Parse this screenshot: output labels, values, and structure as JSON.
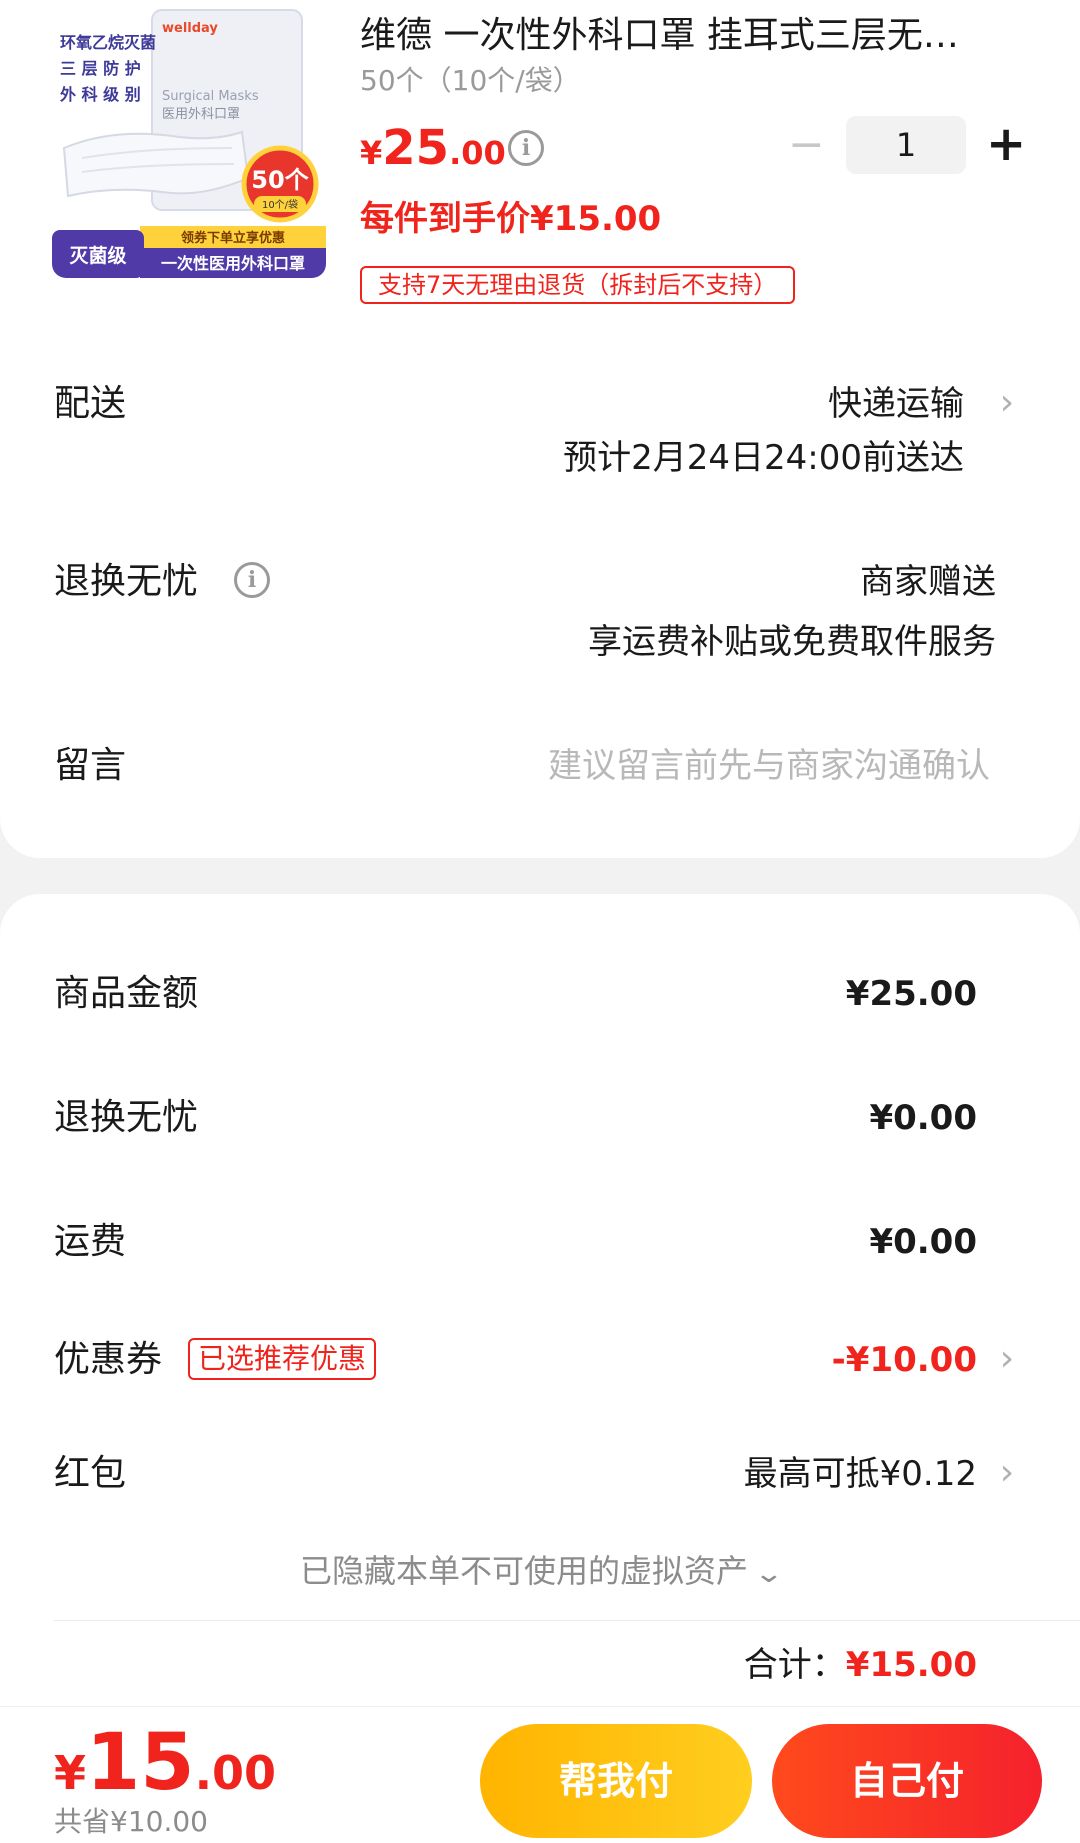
{
  "product": {
    "title": "维德 一次性外科口罩 挂耳式三层无…",
    "spec": "50个（10个/袋）",
    "price_currency": "¥",
    "price_int": "25",
    "price_dec": ".00",
    "quantity": "1",
    "minus_label": "−",
    "plus_label": "+",
    "unit_price": "每件到手价¥15.00",
    "return_tag": "支持7天无理由退货（拆封后不支持）",
    "image_text": {
      "brand": "wellday",
      "line1": "环氧乙烷灭菌",
      "line2": "三 层 防 护",
      "line3": "外 科 级 别",
      "pack_en": "Surgical Masks",
      "pack_cn": "医用外科口罩",
      "badge_count": "50个",
      "badge_sub": "10个/袋",
      "promo": "领券下单立享优惠",
      "left_tag": "灭菌级",
      "bottom_name": "一次性医用外科口罩"
    }
  },
  "delivery": {
    "label": "配送",
    "method": "快递运输",
    "eta": "预计2月24日24:00前送达"
  },
  "worry_free": {
    "label": "退换无忧",
    "value": "商家赠送",
    "desc": "享运费补贴或免费取件服务"
  },
  "message": {
    "label": "留言",
    "placeholder": "建议留言前先与商家沟通确认"
  },
  "summary": {
    "goods_label": "商品金额",
    "goods_value": "¥25.00",
    "worry_label": "退换无忧",
    "worry_value": "¥0.00",
    "shipping_label": "运费",
    "shipping_value": "¥0.00",
    "coupon_label": "优惠券",
    "coupon_tag": "已选推荐优惠",
    "coupon_value": "-¥10.00",
    "redpacket_label": "红包",
    "redpacket_value": "最高可抵¥0.12",
    "hidden_assets": "已隐藏本单不可使用的虚拟资产",
    "total_label": "合计：",
    "total_value": "¥15.00"
  },
  "bottom_bar": {
    "pay_currency": "¥",
    "pay_int": "15",
    "pay_dec": ".00",
    "saved": "共省¥10.00",
    "help_pay": "帮我付",
    "self_pay": "自己付"
  },
  "colors": {
    "accent_red": "#f0241c",
    "help_button": "#ffc107",
    "self_button": "#f5212d",
    "background": "#f2f2f2"
  },
  "icons": {
    "info": "info-circle-icon",
    "chevron": "chevron-right-icon",
    "expand": "chevron-down-icon"
  }
}
